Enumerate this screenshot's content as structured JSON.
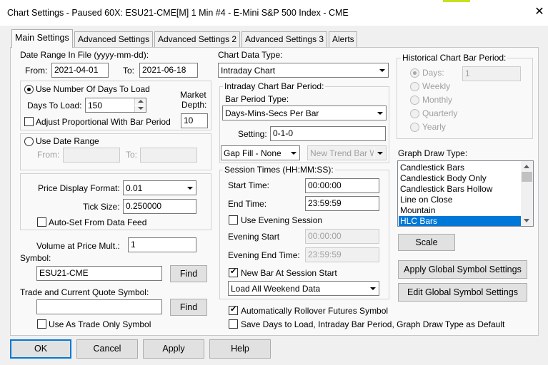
{
  "window": {
    "title": "Chart Settings - Paused 60X: ESU21-CME[M]  1 Min   #4 - E-Mini S&P 500 Index - CME",
    "close_label": "✕"
  },
  "tabs": [
    {
      "label": "Main Settings",
      "active": true
    },
    {
      "label": "Advanced Settings",
      "active": false
    },
    {
      "label": "Advanced Settings 2",
      "active": false
    },
    {
      "label": "Advanced Settings 3",
      "active": false
    },
    {
      "label": "Alerts",
      "active": false
    }
  ],
  "date_range_file": {
    "label": "Date Range In File (yyyy-mm-dd):",
    "from_label": "From:",
    "from_value": "2021-04-01",
    "to_label": "To:",
    "to_value": "2021-06-18"
  },
  "days_group": {
    "use_days_label": "Use Number Of Days To Load",
    "use_days_selected": true,
    "days_to_load_label": "Days To Load:",
    "days_to_load_value": "150",
    "market_depth_label_1": "Market",
    "market_depth_label_2": "Depth:",
    "market_depth_value": "10",
    "adjust_label": "Adjust Proportional With Bar Period",
    "adjust_checked": false
  },
  "date_range_group": {
    "use_date_range_label": "Use Date Range",
    "use_date_range_selected": false,
    "from_label": "From:",
    "from_value": "",
    "to_label": "To:",
    "to_value": ""
  },
  "price_group": {
    "format_label": "Price Display Format:",
    "format_value": "0.01",
    "tick_label": "Tick Size:",
    "tick_value": "0.250000",
    "autoset_label": "Auto-Set From Data Feed",
    "autoset_checked": false
  },
  "volume": {
    "label": "Volume at Price Mult.:",
    "value": "1"
  },
  "symbol": {
    "label": "Symbol:",
    "value": "ESU21-CME",
    "find_label": "Find"
  },
  "trade_symbol": {
    "label": "Trade and Current Quote Symbol:",
    "value": "",
    "find_label": "Find",
    "trade_only_label": "Use As Trade Only Symbol",
    "trade_only_checked": false
  },
  "chart_data_type": {
    "label": "Chart Data Type:",
    "value": "Intraday Chart"
  },
  "intraday_bar": {
    "title": "Intraday Chart Bar Period:",
    "type_label": "Bar Period Type:",
    "type_value": "Days-Mins-Secs Per Bar",
    "setting_label": "Setting:",
    "setting_value": "0-1-0",
    "gap_fill_value": "Gap Fill - None",
    "new_trend_value": "New Trend Bar W"
  },
  "session_times": {
    "title": "Session Times (HH:MM:SS):",
    "start_label": "Start Time:",
    "start_value": "00:00:00",
    "end_label": "End Time:",
    "end_value": "23:59:59",
    "evening_label": "Use Evening Session",
    "evening_checked": false,
    "evening_start_label": "Evening Start",
    "evening_start_value": "00:00:00",
    "evening_end_label": "Evening End Time:",
    "evening_end_value": "23:59:59",
    "new_bar_label": "New Bar At Session Start",
    "new_bar_checked": true,
    "weekend_value": "Load All Weekend Data"
  },
  "historical": {
    "title": "Historical Chart Bar Period:",
    "options": [
      {
        "label": "Days:",
        "selected": true
      },
      {
        "label": "Weekly",
        "selected": false
      },
      {
        "label": "Monthly",
        "selected": false
      },
      {
        "label": "Quarterly",
        "selected": false
      },
      {
        "label": "Yearly",
        "selected": false
      }
    ],
    "days_value": "1"
  },
  "graph_draw": {
    "label": "Graph Draw Type:",
    "items": [
      "Candlestick Bars",
      "Candlestick Body Only",
      "Candlestick Bars Hollow",
      "Line on Close",
      "Mountain",
      "HLC Bars"
    ],
    "selected": "HLC Bars"
  },
  "buttons_right": {
    "scale": "Scale",
    "apply_global": "Apply Global Symbol Settings",
    "edit_global": "Edit Global Symbol Settings"
  },
  "bottom_options": {
    "rollover_label": "Automatically Rollover Futures Symbol",
    "rollover_checked": true,
    "save_default_label": "Save Days to Load, Intraday Bar Period, Graph Draw Type as Default",
    "save_default_checked": false
  },
  "dialog_buttons": {
    "ok": "OK",
    "cancel": "Cancel",
    "apply": "Apply",
    "help": "Help"
  },
  "colors": {
    "selection": "#0078d7",
    "dialog_bg": "#f0f0f0",
    "panel_bg": "#f9f9f9"
  }
}
